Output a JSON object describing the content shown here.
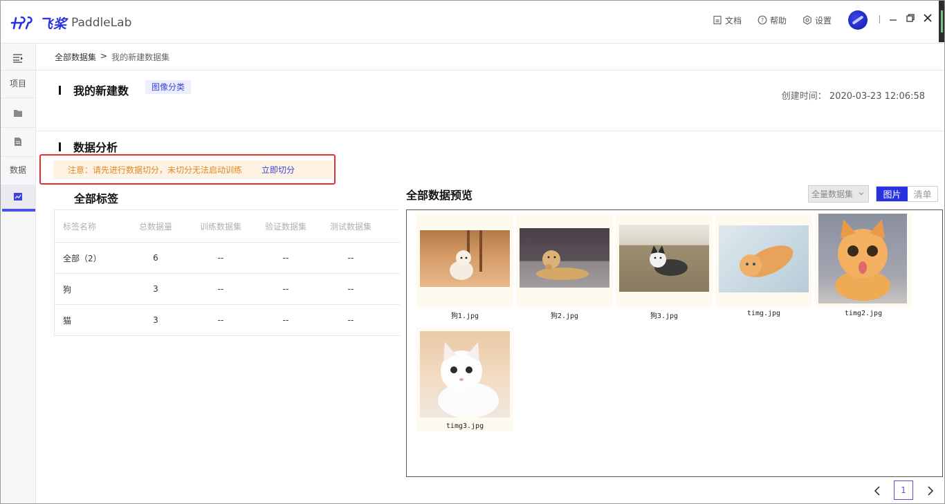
{
  "app": {
    "logo_cn": "飞桨",
    "logo_en": "PaddleLab",
    "accent_color": "#2932e1",
    "warning_border_color": "#e63030"
  },
  "topnav": {
    "docs": "文档",
    "help": "帮助",
    "settings": "设置"
  },
  "rail": {
    "menu_icon": "menu-collapse-icon",
    "project": "项目",
    "data": "数据",
    "icons": [
      "folder-icon",
      "document-icon",
      "chart-icon"
    ]
  },
  "breadcrumb": {
    "root": "全部数据集",
    "separator": ">",
    "current": "我的新建数据集"
  },
  "dataset": {
    "name": "我的新建数",
    "type_tag": "图像分类",
    "created_label": "创建时间：",
    "created_value": "2020-03-23 12:06:58"
  },
  "analysis": {
    "title": "数据分析",
    "warning": "注意：请先进行数据切分，未切分无法启动训练",
    "split_action": "立即切分"
  },
  "labels": {
    "title": "全部标签",
    "headers": [
      "标签名称",
      "总数据量",
      "训练数据集",
      "验证数据集",
      "测试数据集"
    ],
    "rows": [
      [
        "全部（2）",
        "6",
        "--",
        "--",
        "--"
      ],
      [
        "狗",
        "3",
        "--",
        "--",
        "--"
      ],
      [
        "猫",
        "3",
        "--",
        "--",
        "--"
      ]
    ]
  },
  "preview": {
    "title": "全部数据预览",
    "filter_selected": "全量数据集",
    "view_image": "图片",
    "view_list": "清单",
    "images": [
      {
        "name": "狗1.jpg"
      },
      {
        "name": "狗2.jpg"
      },
      {
        "name": "狗3.jpg"
      },
      {
        "name": "timg.jpg"
      },
      {
        "name": "timg2.jpg"
      },
      {
        "name": "timg3.jpg"
      }
    ]
  },
  "pagination": {
    "current": "1"
  }
}
